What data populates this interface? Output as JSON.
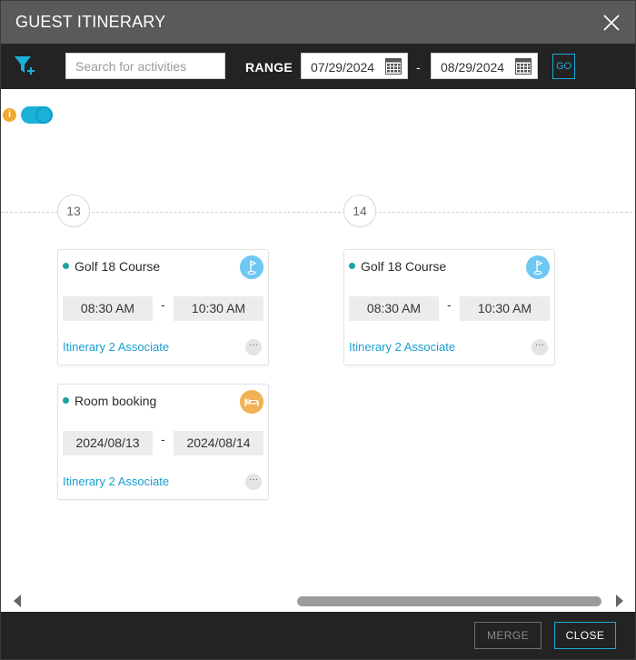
{
  "dialog": {
    "title": "GUEST ITINERARY"
  },
  "toolbar": {
    "search_placeholder": "Search for activities",
    "range_label": "RANGE",
    "start_date": "07/29/2024",
    "end_date": "08/29/2024",
    "date_separator": "-",
    "go_label": "GO"
  },
  "days": [
    {
      "label": "13"
    },
    {
      "label": "14"
    }
  ],
  "cards": [
    {
      "title": "Golf 18 Course",
      "icon": "golf-flag-icon",
      "start": "08:30 AM",
      "end": "10:30 AM",
      "associate": "Itinerary 2 Associate"
    },
    {
      "title": "Room booking",
      "icon": "bed-icon",
      "start": "2024/08/13",
      "end": "2024/08/14",
      "associate": "Itinerary 2 Associate"
    },
    {
      "title": "Golf 18 Course",
      "icon": "golf-flag-icon",
      "start": "08:30 AM",
      "end": "10:30 AM",
      "associate": "Itinerary 2 Associate"
    }
  ],
  "card_separator": "-",
  "more_label": "···",
  "info_icon_glyph": "i",
  "footer": {
    "merge_label": "MERGE",
    "close_label": "CLOSE"
  },
  "colors": {
    "accent": "#1fa8d8",
    "golf_badge": "#6ec8f2",
    "room_badge": "#f2b155",
    "status_dot": "#1aa3a3",
    "info": "#f0a830"
  }
}
